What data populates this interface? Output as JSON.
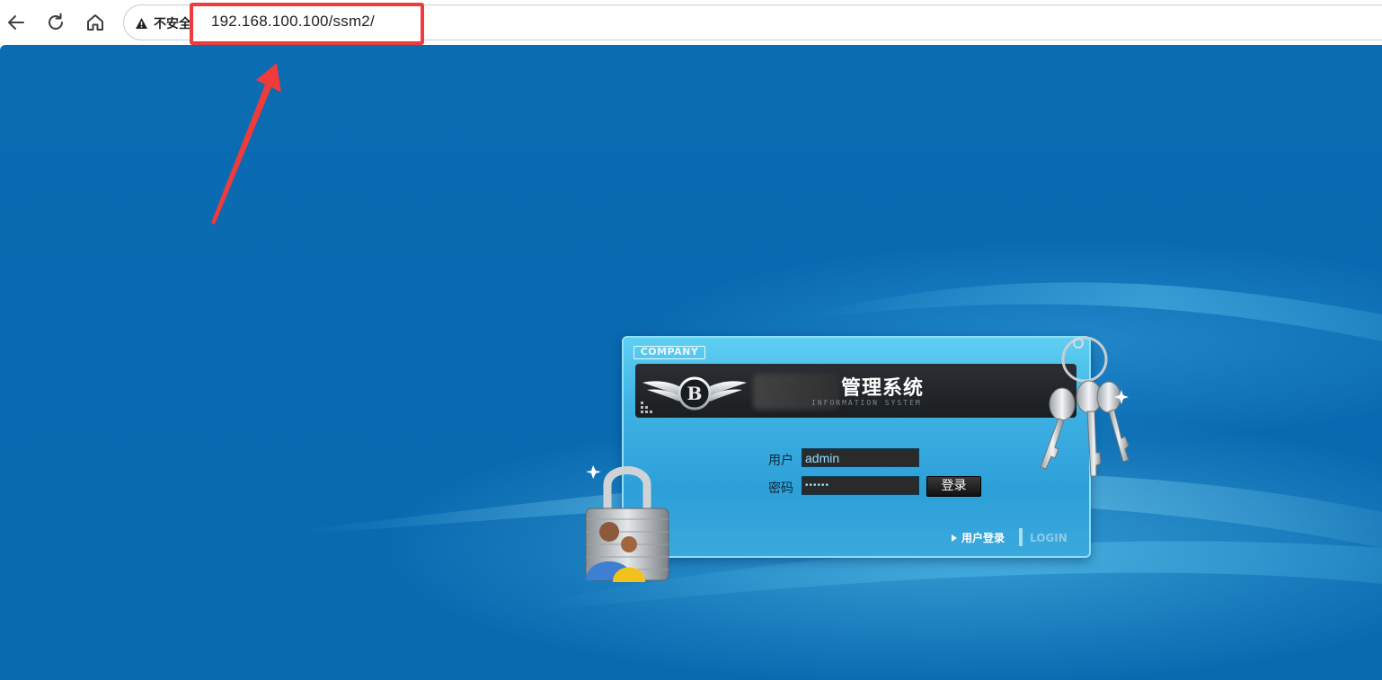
{
  "browser": {
    "security_label": "不安全",
    "url": "192.168.100.100/ssm2/",
    "icons": [
      "back-arrow-icon",
      "reload-icon",
      "home-icon",
      "warning-icon"
    ]
  },
  "login": {
    "company_tag": "COMPANY",
    "system_title": "管理系统",
    "system_subtitle": "INFORMATION SYSTEM",
    "username_label": "用户",
    "username_value": "admin",
    "password_label": "密码",
    "password_value": "••••••",
    "submit_label": "登录",
    "footer_label": "用户登录",
    "footer_en": "LOGIN"
  },
  "colors": {
    "page_background": "#0a6ab1",
    "panel": "#3fb3e4",
    "highlight": "#ee3b3b"
  }
}
